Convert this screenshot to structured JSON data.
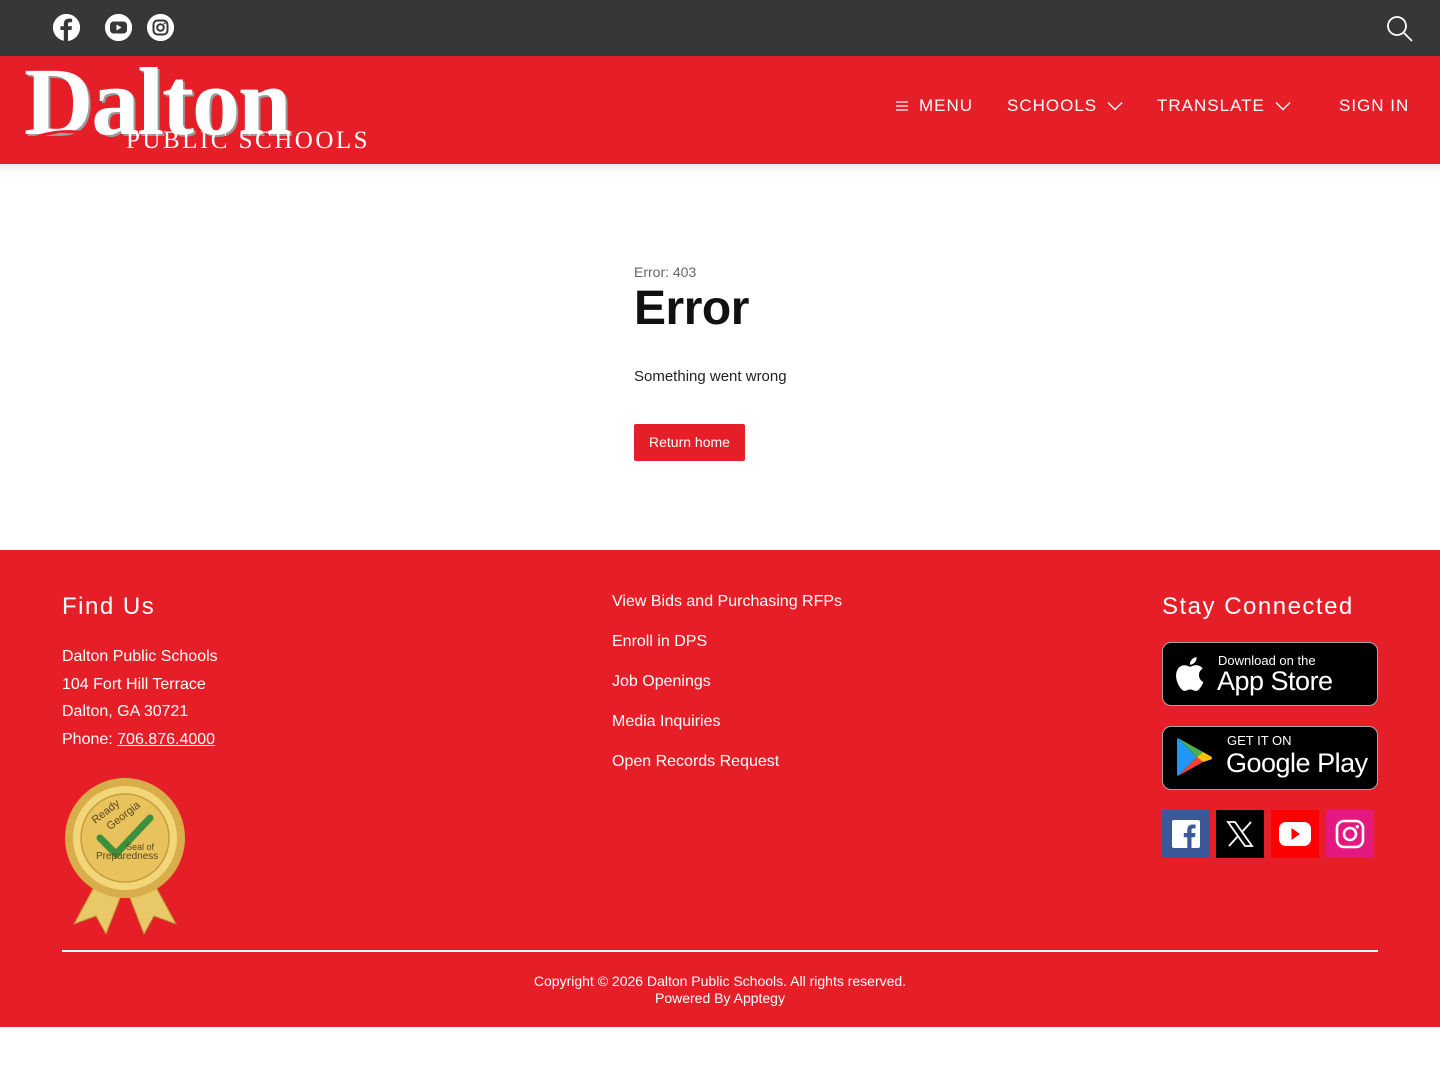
{
  "topbar": {
    "social_icons": [
      "facebook-icon",
      "youtube-icon",
      "instagram-icon"
    ],
    "search_icon": "search-icon"
  },
  "header": {
    "logo_big": "Dalton",
    "logo_small": "PUBLIC SCHOOLS",
    "nav": {
      "menu": "MENU",
      "schools": "SCHOOLS",
      "translate": "TRANSLATE",
      "sign_in": "SIGN IN"
    }
  },
  "main": {
    "error_code": "Error: 403",
    "title": "Error",
    "message": "Something went wrong",
    "button": "Return home"
  },
  "footer": {
    "find_us": {
      "heading": "Find Us",
      "name": "Dalton Public Schools",
      "street": "104 Fort Hill Terrace",
      "city": "Dalton, GA 30721",
      "phone_label": "Phone: ",
      "phone": "706.876.4000"
    },
    "seal": {
      "line1": "Ready",
      "line2": "Georgia",
      "line3": "Seal of",
      "line4": "Preparedness"
    },
    "links": [
      "View Bids and Purchasing RFPs",
      "Enroll in DPS",
      "Job Openings",
      "Media Inquiries",
      "Open Records Request"
    ],
    "stay_connected": {
      "heading": "Stay Connected",
      "app_store_line1": "Download on the",
      "app_store_line2": "App Store",
      "google_line1": "GET IT ON",
      "google_line2": "Google Play"
    },
    "copyright": "Copyright © 2026 Dalton Public Schools. All rights reserved.",
    "powered_by": "Powered By Apptegy"
  },
  "colors": {
    "brand_red": "#e61e28",
    "topbar": "#373737",
    "facebook": "#3b5998",
    "x": "#000000",
    "youtube": "#ff0000",
    "instagram": "#e4187f"
  }
}
